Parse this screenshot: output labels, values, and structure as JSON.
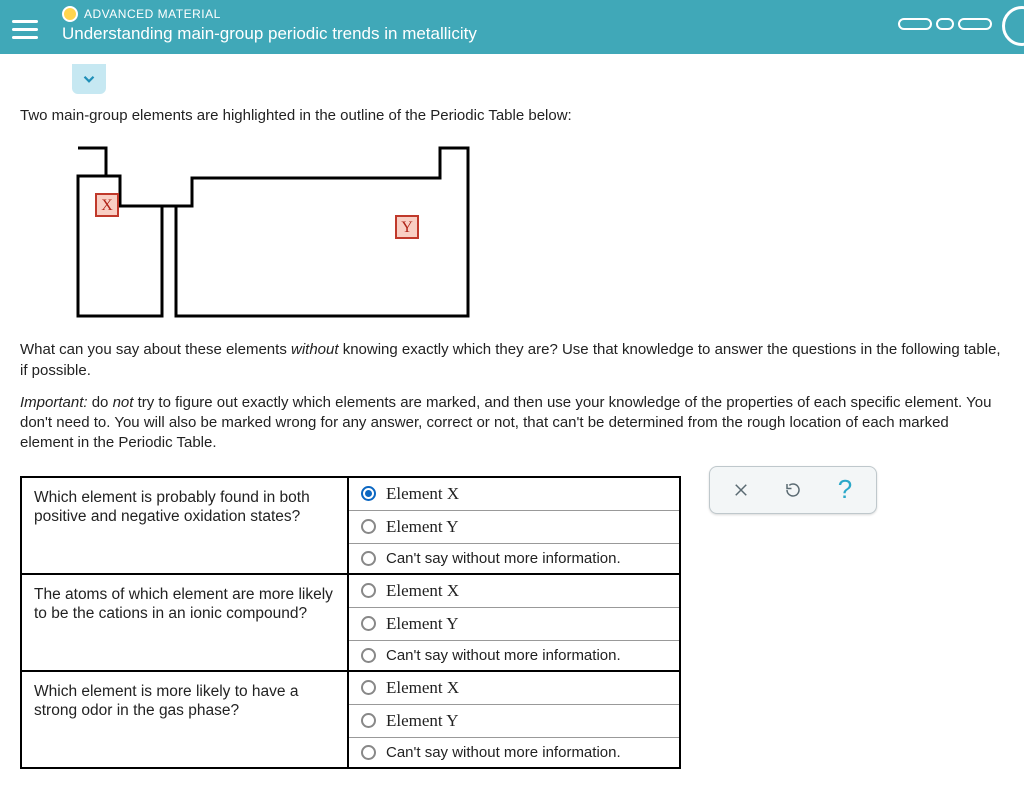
{
  "header": {
    "badge": "ADVANCED MATERIAL",
    "title": "Understanding main-group periodic trends in metallicity"
  },
  "intro": "Two main-group elements are highlighted in the outline of the Periodic Table below:",
  "periodic": {
    "labelX": "X",
    "labelY": "Y"
  },
  "para1_a": "What can you say about these elements ",
  "para1_i": "without",
  "para1_b": " knowing exactly which they are? Use that knowledge to answer the questions in the following table, if possible.",
  "para2_pre": "Important:",
  "para2_a": " do ",
  "para2_i": "not",
  "para2_b": " try to figure out exactly which elements are marked, and then use your knowledge of the properties of each specific element. You don't need to. You will also be marked wrong for any answer, correct or not, that can't be determined from the rough location of each marked element in the Periodic Table.",
  "questions": [
    {
      "q": "Which element is probably found in both positive and negative oxidation states?",
      "opts": [
        "Element X",
        "Element Y",
        "Can't say without more information."
      ],
      "selected": 0
    },
    {
      "q": "The atoms of which element are more likely to be the cations in an ionic compound?",
      "opts": [
        "Element X",
        "Element Y",
        "Can't say without more information."
      ],
      "selected": -1
    },
    {
      "q": "Which element is more likely to have a strong odor in the gas phase?",
      "opts": [
        "Element X",
        "Element Y",
        "Can't say without more information."
      ],
      "selected": -1
    }
  ]
}
